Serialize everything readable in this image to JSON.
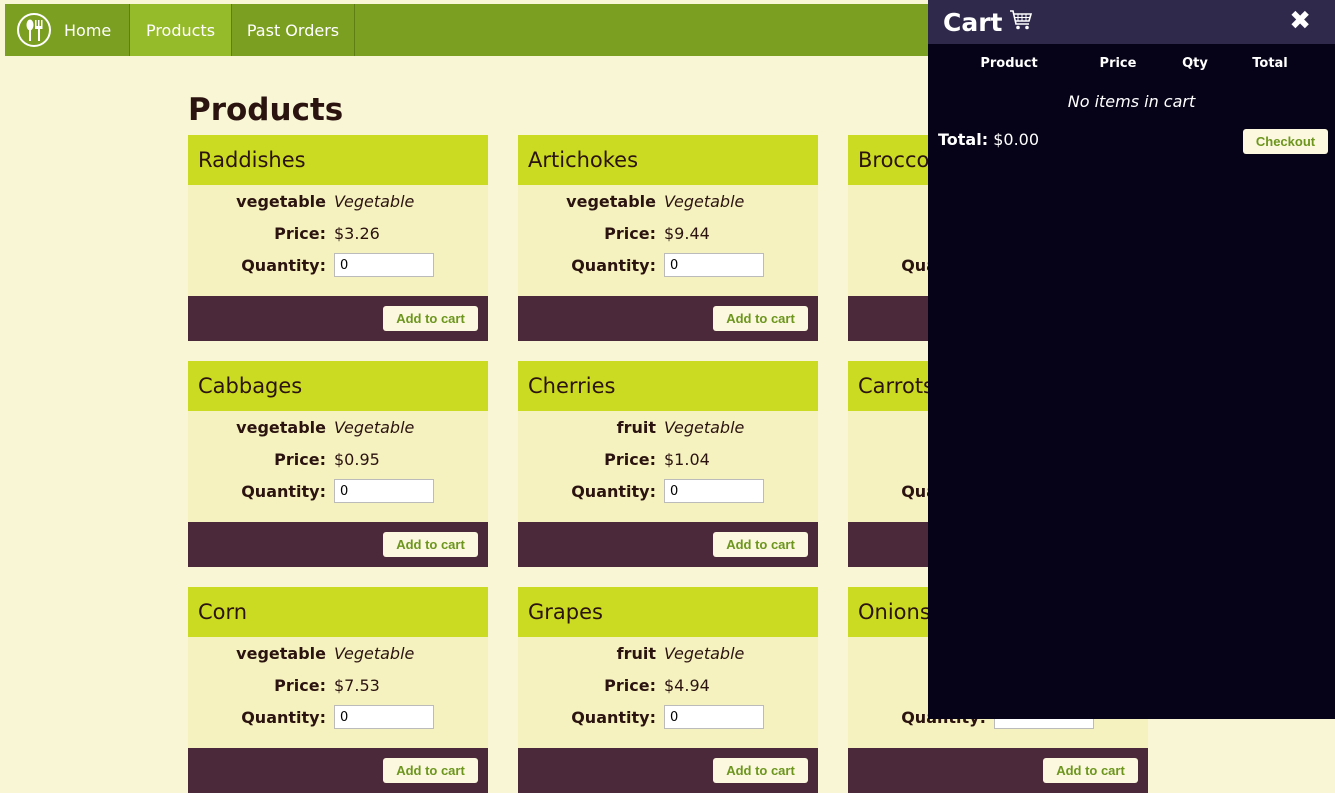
{
  "nav": {
    "home": "Home",
    "products": "Products",
    "past_orders": "Past Orders"
  },
  "page": {
    "heading": "Products"
  },
  "labels": {
    "price": "Price:",
    "quantity": "Quantity:",
    "add_to_cart": "Add to cart"
  },
  "products": [
    {
      "name": "Raddishes",
      "category": "vegetable",
      "type": "Vegetable",
      "price": "$3.26",
      "qty": "0"
    },
    {
      "name": "Artichokes",
      "category": "vegetable",
      "type": "Vegetable",
      "price": "$9.44",
      "qty": "0"
    },
    {
      "name": "Brocco",
      "category": "ve",
      "type": "",
      "price": "",
      "qty": ""
    },
    {
      "name": "Cabbages",
      "category": "vegetable",
      "type": "Vegetable",
      "price": "$0.95",
      "qty": "0"
    },
    {
      "name": "Cherries",
      "category": "fruit",
      "type": "Vegetable",
      "price": "$1.04",
      "qty": "0"
    },
    {
      "name": "Carrots",
      "category": "ve",
      "type": "",
      "price": "",
      "qty": ""
    },
    {
      "name": "Corn",
      "category": "vegetable",
      "type": "Vegetable",
      "price": "$7.53",
      "qty": "0"
    },
    {
      "name": "Grapes",
      "category": "fruit",
      "type": "Vegetable",
      "price": "$4.94",
      "qty": "0"
    },
    {
      "name": "Onions",
      "category": "ve",
      "type": "",
      "price": "",
      "qty": ""
    }
  ],
  "cart": {
    "title": "Cart",
    "close": "✖",
    "columns": [
      "Product",
      "Price",
      "Qty",
      "Total"
    ],
    "empty_message": "No items in cart",
    "total_label": "Total:",
    "total_value": "$0.00",
    "checkout": "Checkout"
  },
  "colors": {
    "nav": "#7ba021",
    "nav_active": "#95bb2b",
    "card_head": "#cbdb22",
    "card_body": "#f5f2c0",
    "card_foot": "#4b283a",
    "cart_bg": "#060318",
    "cart_header": "#2f2a4b",
    "button_text": "#6d961d"
  }
}
